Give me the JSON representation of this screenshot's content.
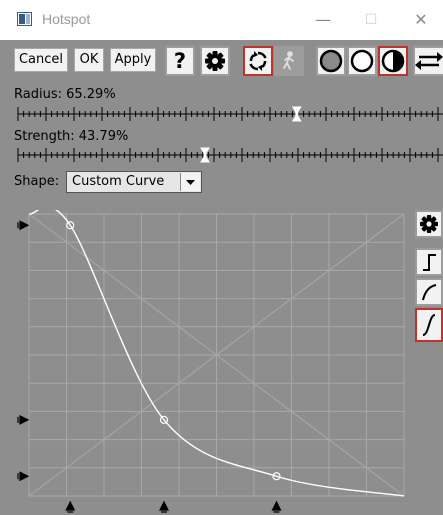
{
  "window": {
    "title": "Hotspot",
    "minimize": "—",
    "maximize": "☐",
    "close": "✕"
  },
  "toolbar": {
    "cancel_label": "Cancel",
    "ok_label": "OK",
    "apply_label": "Apply",
    "help_label": "?"
  },
  "radius": {
    "label": "Radius: 65.29%",
    "value": 0.6529
  },
  "strength": {
    "label": "Strength: 43.79%",
    "value": 0.4379
  },
  "shape": {
    "label": "Shape:",
    "selected": "Custom Curve"
  },
  "curve": {
    "control_points": [
      {
        "x": 0.11,
        "y": 0.96
      },
      {
        "x": 0.36,
        "y": 0.27
      },
      {
        "x": 0.66,
        "y": 0.07
      }
    ]
  },
  "colors": {
    "panel_bg": "#8e8e8e",
    "active_border": "#c0322c",
    "curve": "#ffffff"
  },
  "icons": [
    "app-icon",
    "help-icon",
    "gear-icon",
    "refresh-icon",
    "figure-icon",
    "circle-dark-icon",
    "circle-white-icon",
    "circle-half-icon",
    "swap-arrows-icon",
    "step-curve-icon",
    "gradual-curve-icon",
    "s-curve-icon"
  ]
}
